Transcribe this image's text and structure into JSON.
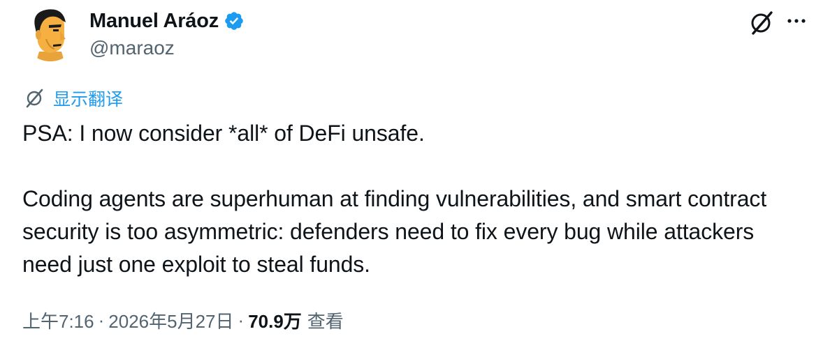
{
  "author": {
    "display_name": "Manuel Aráoz",
    "handle": "@maraoz",
    "verified_color": "#1d9bf0"
  },
  "header": {
    "grok_icon": "grok-icon",
    "more_icon": "more-horizontal-icon"
  },
  "translate": {
    "label": "显示翻译",
    "icon": "translate-icon"
  },
  "tweet": {
    "paragraphs": [
      "PSA: I now consider *all* of DeFi unsafe.",
      "",
      "Coding agents are superhuman at finding vulnerabilities, and smart contract security is too asymmetric: defenders need to fix every bug while attackers need just one exploit to steal funds."
    ]
  },
  "meta": {
    "time": "上午7:16",
    "date": "2026年5月27日",
    "views_count": "70.9万",
    "views_label": "查看",
    "separator": "·"
  },
  "colors": {
    "text": "#0f1419",
    "secondary": "#536471",
    "link": "#1d9bf0",
    "avatar_bg": "#ffffff",
    "avatar_skin": "#f5b041",
    "avatar_hair": "#1a1a1a"
  }
}
